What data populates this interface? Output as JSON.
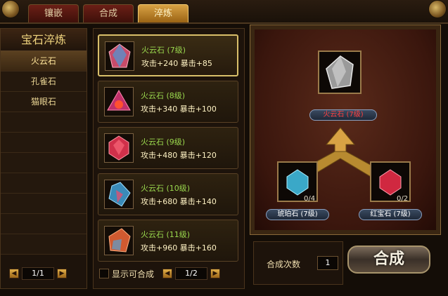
{
  "tabs": [
    {
      "label": "镶嵌"
    },
    {
      "label": "合成"
    },
    {
      "label": "淬炼"
    }
  ],
  "active_tab": "淬炼",
  "left_panel": {
    "title": "宝石淬炼",
    "categories": [
      {
        "label": "火云石"
      },
      {
        "label": "孔雀石"
      },
      {
        "label": "猫眼石"
      }
    ],
    "page": "1/1"
  },
  "middle_panel": {
    "items": [
      {
        "name": "火云石 (7级)",
        "stats": "攻击+240  暴击+85"
      },
      {
        "name": "火云石 (8级)",
        "stats": "攻击+340  暴击+100"
      },
      {
        "name": "火云石 (9级)",
        "stats": "攻击+480  暴击+120"
      },
      {
        "name": "火云石 (10级)",
        "stats": "攻击+680  暴击+140"
      },
      {
        "name": "火云石 (11级)",
        "stats": "攻击+960  暴击+160"
      }
    ],
    "show_craftable_label": "显示可合成",
    "page": "1/2"
  },
  "right_panel": {
    "result": {
      "label": "火云石 (7级)"
    },
    "materials": [
      {
        "label": "琥珀石 (7级)",
        "count": "0/4"
      },
      {
        "label": "红宝石 (7级)",
        "count": "0/2"
      }
    ]
  },
  "craft": {
    "count_label": "合成次数",
    "count_value": "1",
    "button_label": "合成"
  },
  "colors": {
    "accent": "#d8a244",
    "item_name": "#9ad84e",
    "result_label": "#ff4040"
  }
}
